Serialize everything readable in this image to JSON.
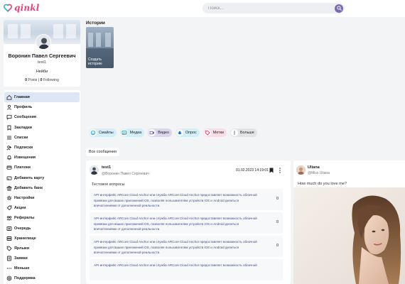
{
  "header": {
    "logo_text": "qinkl",
    "search_placeholder": "Поиск..."
  },
  "profile": {
    "name": "Воронин Павел Сергеевич",
    "nickname": "test1",
    "status": "Нейби",
    "posts_count": "0",
    "posts_label": "Posts",
    "following_count": "0",
    "following_label": "Following",
    "separator": "|"
  },
  "menu": {
    "items": [
      {
        "label": "Главная",
        "icon": "home-icon",
        "active": true
      },
      {
        "label": "Профиль",
        "icon": "user-icon"
      },
      {
        "label": "Сообщения",
        "icon": "chat-icon"
      },
      {
        "label": "Закладки",
        "icon": "bookmark-icon"
      },
      {
        "label": "Списки",
        "icon": "list-icon"
      },
      {
        "label": "Подписки",
        "icon": "subscriptions-icon"
      },
      {
        "label": "Извещения",
        "icon": "bell-icon"
      },
      {
        "label": "Платежи",
        "icon": "payment-icon"
      },
      {
        "label": "Добавить карту",
        "icon": "card-icon"
      },
      {
        "label": "Добавить банк",
        "icon": "bank-icon"
      },
      {
        "label": "Настройки",
        "icon": "gear-icon"
      },
      {
        "label": "Акции",
        "icon": "promo-icon"
      },
      {
        "label": "Рефералы",
        "icon": "referral-icon"
      },
      {
        "label": "Очередь",
        "icon": "queue-icon"
      },
      {
        "label": "Хранилище",
        "icon": "storage-icon"
      },
      {
        "label": "Ярлыки",
        "icon": "tag-icon"
      },
      {
        "label": "Заявки",
        "icon": "requests-icon"
      },
      {
        "label": "Меньше",
        "icon": "less-icon"
      },
      {
        "label": "Поддержка",
        "icon": "support-icon"
      }
    ]
  },
  "stories": {
    "title": "Истории",
    "create_label_line1": "Создать",
    "create_label_line2": "историю"
  },
  "filters": [
    {
      "label": "Смайлы",
      "icon": "smile-icon",
      "bg": "#d4eef7",
      "icon_color": "#2e9cc4"
    },
    {
      "label": "Медиа",
      "icon": "media-icon",
      "bg": "#d4eef7",
      "icon_color": "#2e9cc4"
    },
    {
      "label": "Видео",
      "icon": "video-icon",
      "bg": "#dcd6ec",
      "icon_color": "#6a56a8"
    },
    {
      "label": "Опрос",
      "icon": "poll-icon",
      "bg": "#d4eef7",
      "icon_color": "#1f74c9"
    },
    {
      "label": "Метки",
      "icon": "tag-icon",
      "bg": "#f9dde5",
      "icon_color": "#d23a66"
    },
    {
      "label": "Больше",
      "icon": "more-icon",
      "bg": "#e2e3e6",
      "icon_color": "#555"
    }
  ],
  "tabs": {
    "all_messages": "Все сообщения"
  },
  "post": {
    "author": "test1",
    "handle": "@Воронин Павел Сергеевич",
    "date": "01.02.2023 14:19:01",
    "text": "Тестовое вопросы",
    "quests": [
      {
        "line1": "API-интерфейс ARCore Cloud Anchor или служба ARCore Cloud Anchor предоставляет возможность облачной",
        "line2": "привязки для ваших приложений iOS, позволяя пользователям устройств iOS и Android делиться",
        "line3": "впечатлениями от дополненной реальности.",
        "count": "0"
      },
      {
        "line1": "API-интерфейс ARCore Cloud Anchor или служба ARCore Cloud Anchor предоставляет возможность облачной",
        "line2": "привязки для ваших приложений iOS, позволяя пользователям устройств iOS и Android делиться",
        "line3": "впечатлениями от дополненной реальности.",
        "count": "0"
      },
      {
        "line1": "API-интерфейс ARCore Cloud Anchor или служба ARCore Cloud Anchor предоставляет возможность облачной",
        "line2": "привязки для ваших приложений iOS, позволяя пользователям устройств iOS и Android делиться",
        "line3": "впечатлениями от дополненной реальности.",
        "count": "0"
      },
      {
        "line1": "API-интерфейс ARCore Cloud Anchor или служба ARCore Cloud Anchor предоставляет возможность облачной",
        "line2": "",
        "line3": "",
        "count": ""
      }
    ]
  },
  "side_post": {
    "author": "Uliana",
    "handle": "@Miss Uliana",
    "text": "How much do you love me?"
  },
  "colors": {
    "accent": "#7c6bb3",
    "brand": "#e0457b",
    "active_menu": "#dde6f5",
    "link_text": "#3f4a8a"
  }
}
